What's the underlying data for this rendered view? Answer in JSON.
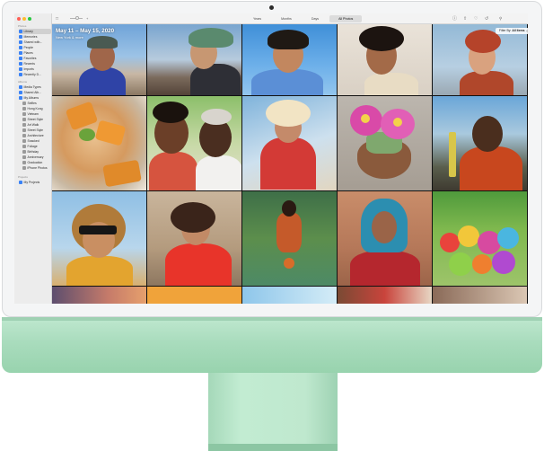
{
  "window": {
    "toolbar": {
      "zoom_label": "",
      "segments": [
        {
          "label": "Years"
        },
        {
          "label": "Months"
        },
        {
          "label": "Days"
        },
        {
          "label": "All Photos"
        }
      ],
      "icons": [
        "info-icon",
        "share-icon",
        "heart-icon",
        "rotate-icon",
        "search-icon"
      ]
    },
    "sidebar": {
      "sections": [
        {
          "title": "Photos"
        },
        {
          "title": "Albums"
        },
        {
          "title": "Projects"
        }
      ],
      "items": [
        {
          "label": "Library",
          "active": true
        },
        {
          "label": "Memories"
        },
        {
          "label": "Shared with..."
        },
        {
          "label": "People"
        },
        {
          "label": "Places"
        },
        {
          "label": "Favorites"
        },
        {
          "label": "Recents"
        },
        {
          "label": "Imports"
        },
        {
          "label": "Recently D..."
        },
        {
          "label": "Media Types"
        },
        {
          "label": "Shared Alb..."
        },
        {
          "label": "My Albums"
        },
        {
          "label": "Selfies"
        },
        {
          "label": "Hong Kong"
        },
        {
          "label": "Vietnam"
        },
        {
          "label": "Street Style"
        },
        {
          "label": "Art Walk"
        },
        {
          "label": "Street Style"
        },
        {
          "label": "Architecture"
        },
        {
          "label": "Snacked"
        },
        {
          "label": "Foliage"
        },
        {
          "label": "Birthday"
        },
        {
          "label": "Anniversary"
        },
        {
          "label": "Graduation"
        },
        {
          "label": "iPhone Photos"
        },
        {
          "label": "My Projects"
        }
      ]
    },
    "header": {
      "date_range": "May 11 – May 15, 2020",
      "location": "New York & more"
    },
    "filter": {
      "prefix": "Filter By:",
      "value": "All Items"
    },
    "photos": [
      {
        "subject": "woman-eating-rooftop"
      },
      {
        "subject": "man-bucket-hat-city"
      },
      {
        "subject": "woman-smiling-blue-sky"
      },
      {
        "subject": "man-curly-hair-laughing"
      },
      {
        "subject": "man-red-hair-portrait"
      },
      {
        "subject": "food-flatbread"
      },
      {
        "subject": "couple-smiling"
      },
      {
        "subject": "person-red-sweater-sunlight"
      },
      {
        "subject": "cactus-flowers"
      },
      {
        "subject": "man-yellow-nails-street"
      },
      {
        "subject": "woman-sunglasses-curly-hair"
      },
      {
        "subject": "woman-red-top-laughing"
      },
      {
        "subject": "basketball-player"
      },
      {
        "subject": "woman-blue-hair-portrait"
      },
      {
        "subject": "colorful-balloons"
      },
      {
        "subject": "partial-1"
      },
      {
        "subject": "partial-2"
      },
      {
        "subject": "partial-3"
      },
      {
        "subject": "partial-4"
      },
      {
        "subject": "partial-5"
      }
    ]
  }
}
